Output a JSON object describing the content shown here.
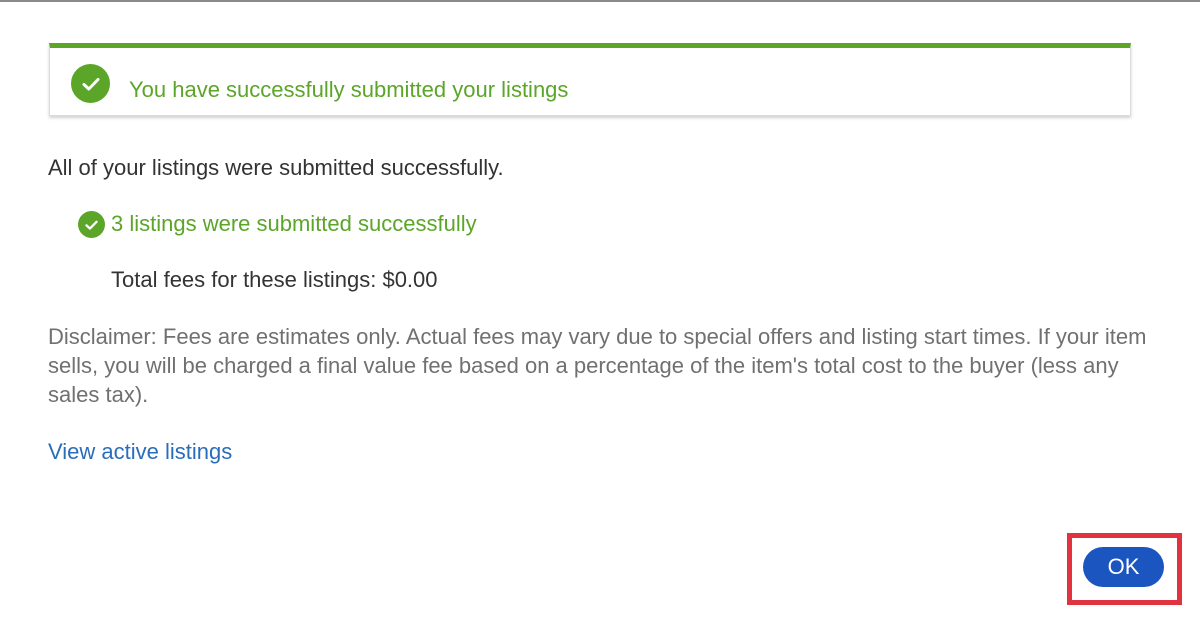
{
  "banner": {
    "message": "You have successfully submitted your listings",
    "icon": "check-circle-icon"
  },
  "summary": {
    "text": "All of your listings were submitted successfully."
  },
  "submitted": {
    "text": "3 listings were submitted successfully",
    "icon": "check-circle-icon"
  },
  "fees": {
    "text": "Total fees for these listings: $0.00"
  },
  "disclaimer": {
    "text": "Disclaimer: Fees are estimates only. Actual fees may vary due to special offers and listing start times. If your item sells, you will be charged a final value fee based on a percentage of the item's total cost to the buyer (less any sales tax)."
  },
  "links": {
    "view_active": "View active listings"
  },
  "actions": {
    "ok_label": "OK"
  },
  "colors": {
    "success_green": "#5ba529",
    "link_blue": "#2a6ebb",
    "button_blue": "#1b55c0",
    "highlight_red": "#e0323f"
  }
}
